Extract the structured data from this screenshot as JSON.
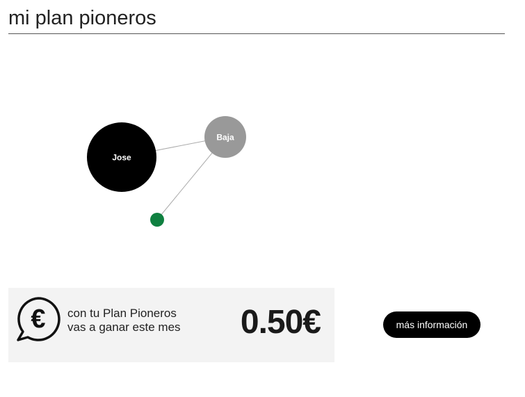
{
  "page": {
    "title": "mi plan pioneros"
  },
  "network": {
    "nodes": [
      {
        "id": "jose",
        "label": "Jose",
        "color": "#000000"
      },
      {
        "id": "baja",
        "label": "Baja",
        "color": "#999999"
      },
      {
        "id": "pending",
        "label": "",
        "color": "#0f8040"
      }
    ],
    "edges": [
      {
        "from": "jose",
        "to": "baja"
      },
      {
        "from": "baja",
        "to": "pending"
      }
    ],
    "edge_color": "#aaaaaa"
  },
  "earnings": {
    "icon": "euro-chat-icon",
    "line1": "con tu Plan Pioneros",
    "line2": "vas a ganar este mes",
    "amount": "0.50€"
  },
  "more_button": {
    "label": "más información"
  }
}
